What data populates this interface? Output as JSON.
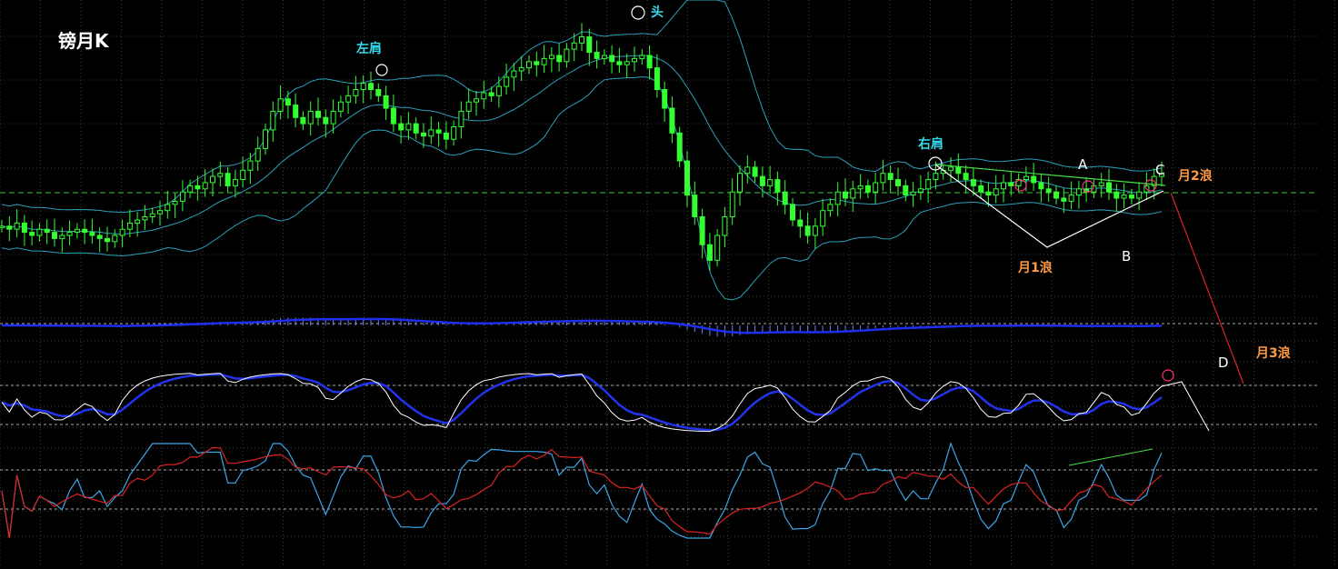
{
  "chart_title": "镑月K",
  "colors": {
    "background": "#000000",
    "grid": "#3a3a3a",
    "candle": "#33ff33",
    "bollinger": "#2aa0b8",
    "macd_line": "#1f2ff0",
    "macd_hist": "#6b7cff",
    "kdj_k": "#ffffff",
    "kdj_d": "#2233ee",
    "rsi_fast": "#3aa6e8",
    "rsi_slow": "#dd2222",
    "trend_green": "#44dd44",
    "projection_red": "#dd2222",
    "label_cyan": "#33ddee",
    "label_orange": "#ff9944",
    "label_white": "#ffffff",
    "marker_pink": "#ff3377"
  },
  "annotations": {
    "left_shoulder": "左肩",
    "head": "头",
    "right_shoulder": "右肩",
    "point_a": "A",
    "point_b": "B",
    "point_c": "C",
    "point_d": "D",
    "wave1": "月1浪",
    "wave2": "月2浪",
    "wave3": "月3浪"
  },
  "chart_data": {
    "type": "candlestick",
    "title": "镑月K",
    "price_closes": [
      1.55,
      1.54,
      1.56,
      1.53,
      1.52,
      1.54,
      1.53,
      1.51,
      1.52,
      1.53,
      1.54,
      1.53,
      1.52,
      1.51,
      1.5,
      1.52,
      1.54,
      1.56,
      1.57,
      1.58,
      1.59,
      1.6,
      1.62,
      1.63,
      1.66,
      1.68,
      1.67,
      1.69,
      1.71,
      1.72,
      1.68,
      1.7,
      1.73,
      1.76,
      1.8,
      1.86,
      1.92,
      1.96,
      1.94,
      1.9,
      1.88,
      1.92,
      1.9,
      1.88,
      1.92,
      1.95,
      1.97,
      1.99,
      2.01,
      1.99,
      1.97,
      1.93,
      1.88,
      1.86,
      1.88,
      1.85,
      1.84,
      1.86,
      1.85,
      1.83,
      1.87,
      1.92,
      1.95,
      1.96,
      1.98,
      1.97,
      2.0,
      2.03,
      2.05,
      2.06,
      2.08,
      2.07,
      2.09,
      2.1,
      2.08,
      2.12,
      2.14,
      2.16,
      2.11,
      2.09,
      2.1,
      2.08,
      2.07,
      2.08,
      2.09,
      2.1,
      2.06,
      1.99,
      1.93,
      1.85,
      1.76,
      1.65,
      1.58,
      1.49,
      1.44,
      1.52,
      1.58,
      1.66,
      1.72,
      1.74,
      1.71,
      1.68,
      1.7,
      1.66,
      1.62,
      1.57,
      1.55,
      1.52,
      1.55,
      1.6,
      1.62,
      1.66,
      1.64,
      1.67,
      1.68,
      1.66,
      1.69,
      1.72,
      1.7,
      1.68,
      1.65,
      1.66,
      1.67,
      1.7,
      1.72,
      1.73,
      1.74,
      1.72,
      1.7,
      1.68,
      1.66,
      1.65,
      1.67,
      1.69,
      1.68,
      1.7,
      1.71,
      1.69,
      1.67,
      1.66,
      1.64,
      1.63,
      1.65,
      1.67,
      1.66,
      1.68,
      1.69,
      1.66,
      1.64,
      1.65,
      1.64,
      1.66,
      1.68,
      1.71,
      1.72
    ],
    "indicators": [
      "Bollinger Bands",
      "MACD",
      "KDJ",
      "RSI"
    ]
  }
}
